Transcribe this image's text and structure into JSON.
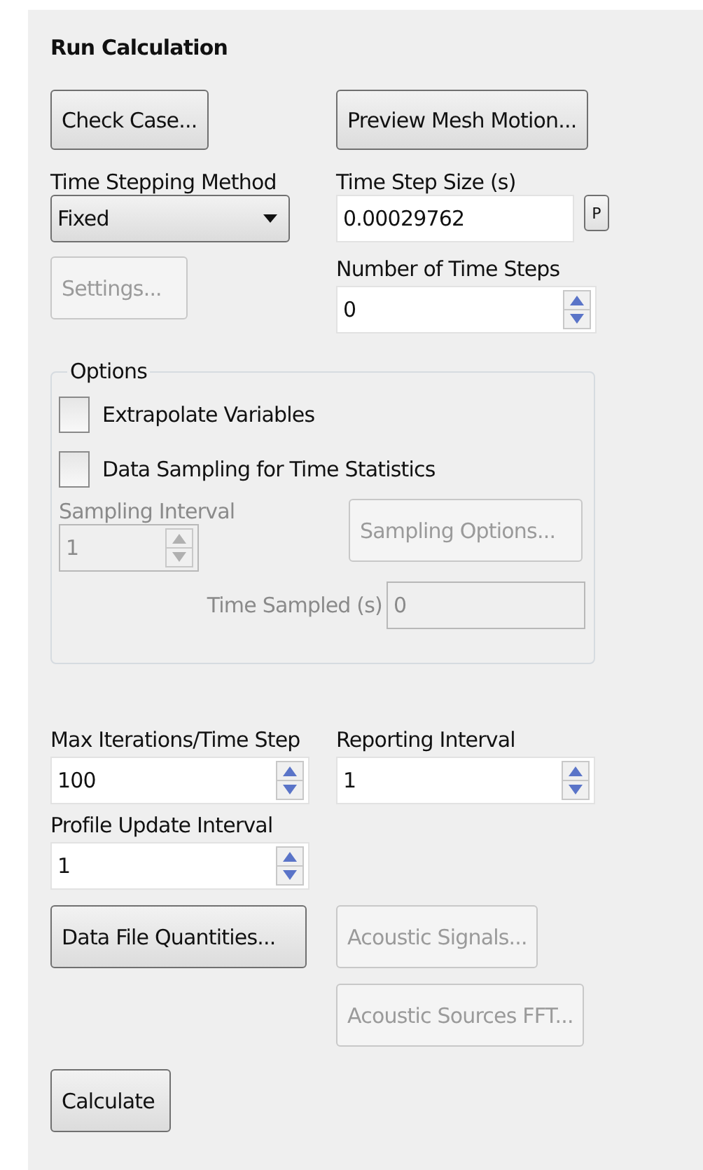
{
  "title": "Run Calculation",
  "top_buttons": [
    {
      "label": "Check Case...",
      "disabled": false
    },
    {
      "label": "Preview Mesh Motion...",
      "disabled": false
    }
  ],
  "time_stepping_method": {
    "label": "Time Stepping Method",
    "value": "Fixed"
  },
  "time_step_size": {
    "label": "Time Step Size (s)",
    "value": "0.00029762",
    "param_button": "P"
  },
  "settings_button": {
    "label": "Settings...",
    "disabled": true
  },
  "number_of_time_steps": {
    "label": "Number of Time Steps",
    "value": "0",
    "disabled": false
  },
  "options": {
    "title": "Options",
    "checkboxes": [
      {
        "label": "Extrapolate Variables",
        "checked": false
      },
      {
        "label": "Data Sampling for Time Statistics",
        "checked": false
      }
    ],
    "sampling_interval": {
      "label": "Sampling Interval",
      "value": "1",
      "disabled": true
    },
    "sampling_options_button": {
      "label": "Sampling Options...",
      "disabled": true
    },
    "time_sampled": {
      "label": "Time Sampled (s)",
      "value": "0",
      "disabled": true
    }
  },
  "max_iterations": {
    "label": "Max Iterations/Time Step",
    "value": "100",
    "disabled": false
  },
  "reporting_interval": {
    "label": "Reporting Interval",
    "value": "1",
    "disabled": false
  },
  "profile_update_interval": {
    "label": "Profile Update Interval",
    "value": "1",
    "disabled": false
  },
  "data_file_button": {
    "label": "Data File Quantities...",
    "disabled": false
  },
  "acoustic_buttons": [
    {
      "label": "Acoustic Signals...",
      "disabled": true
    },
    {
      "label": "Acoustic Sources FFT...",
      "disabled": true
    }
  ],
  "calculate_button": {
    "label": "Calculate",
    "disabled": false
  }
}
